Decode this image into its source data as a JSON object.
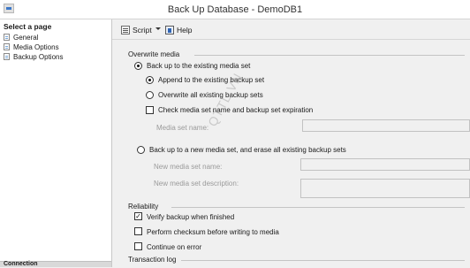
{
  "window": {
    "title": "Back Up Database - DemoDB1"
  },
  "sidebar": {
    "header": "Select a page",
    "items": [
      {
        "label": "General"
      },
      {
        "label": "Media Options"
      },
      {
        "label": "Backup Options"
      }
    ],
    "footer": "Connection"
  },
  "toolbar": {
    "script_label": "Script",
    "help_label": "Help"
  },
  "overwrite_media": {
    "header": "Overwrite media",
    "existing_media_set": {
      "label": "Back up to the existing media set",
      "selected": true
    },
    "append": {
      "label": "Append to the existing backup set",
      "selected": true
    },
    "overwrite_all": {
      "label": "Overwrite all existing backup sets",
      "selected": false
    },
    "check_name": {
      "label": "Check media set name and backup set expiration",
      "checked": false
    },
    "media_set_name_label": "Media set name:",
    "new_media_set": {
      "label": "Back up to a new media set, and erase all existing backup sets",
      "selected": false
    },
    "new_media_set_name_label": "New media set name:",
    "new_media_set_desc_label": "New media set description:"
  },
  "reliability": {
    "header": "Reliability",
    "verify": {
      "label": "Verify backup when finished",
      "checked": true
    },
    "checksum": {
      "label": "Perform checksum before writing to media",
      "checked": false
    },
    "continue_on_error": {
      "label": "Continue on error",
      "checked": false
    }
  },
  "transaction_log": {
    "header": "Transaction log"
  },
  "watermark": "QTTL.VN"
}
